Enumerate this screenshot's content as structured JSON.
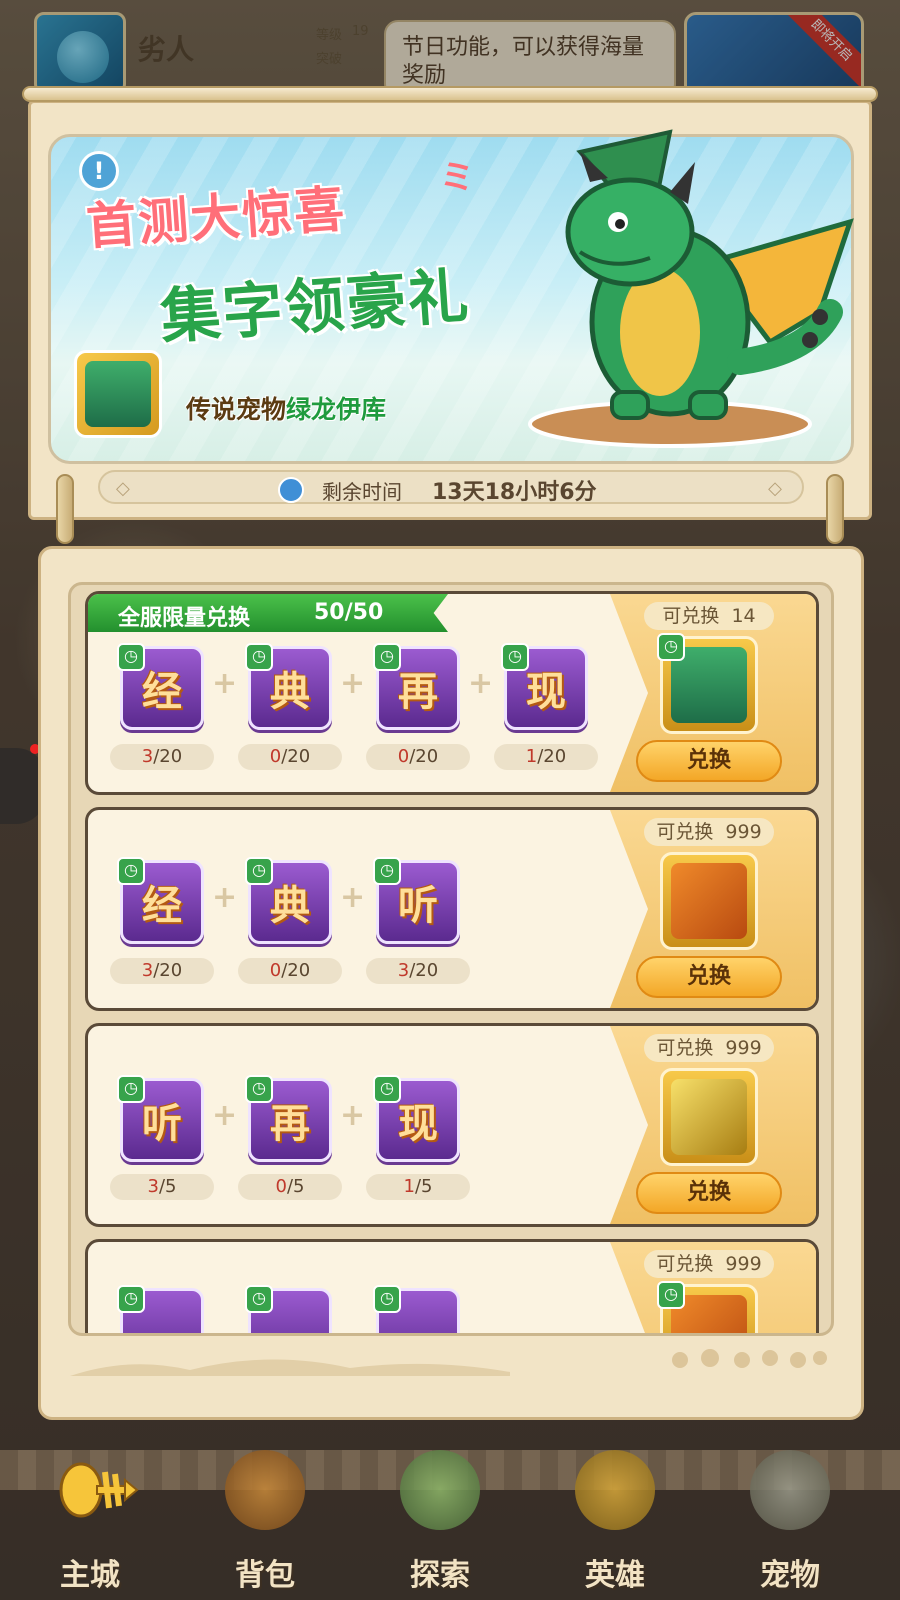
{
  "colors": {
    "accent_green": "#29a44a",
    "accent_pink": "#ff6f79",
    "panel_bg": "#f2e4c6",
    "button_orange": "#f3a727",
    "count_red": "#c0392b"
  },
  "top_bar": {
    "player_name": "劣人",
    "level_label": "等级",
    "level_value": "19",
    "breakthrough_label": "突破",
    "notice_text": "节日功能，可以获得海量奖励",
    "event_ribbon": "即将开启"
  },
  "banner": {
    "headline_1": "首测大惊喜",
    "headline_2": "集字领豪礼",
    "pet_caption_prefix": "传说宠物",
    "pet_caption_name": "绿龙伊库",
    "info_icon": "exclamation-icon"
  },
  "timer": {
    "label": "剩余时间",
    "value": "13天18小时6分"
  },
  "limit_tag": {
    "label": "全服限量兑换",
    "value": "50/50"
  },
  "cards": [
    {
      "items": [
        {
          "char": "经",
          "have": "3",
          "need": "/20"
        },
        {
          "char": "典",
          "have": "0",
          "need": "/20"
        },
        {
          "char": "再",
          "have": "0",
          "need": "/20"
        },
        {
          "char": "现",
          "have": "1",
          "need": "/20"
        }
      ],
      "can_label": "可兑换",
      "can_value": "14",
      "reward": "green-dragon-pet",
      "button": "兑换"
    },
    {
      "items": [
        {
          "char": "经",
          "have": "3",
          "need": "/20"
        },
        {
          "char": "典",
          "have": "0",
          "need": "/20"
        },
        {
          "char": "听",
          "have": "3",
          "need": "/20"
        }
      ],
      "can_label": "可兑换",
      "can_value": "999",
      "reward": "orange-rune-stone",
      "button": "兑换"
    },
    {
      "items": [
        {
          "char": "听",
          "have": "3",
          "need": "/5"
        },
        {
          "char": "再",
          "have": "0",
          "need": "/5"
        },
        {
          "char": "现",
          "have": "1",
          "need": "/5"
        }
      ],
      "can_label": "可兑换",
      "can_value": "999",
      "reward": "gold-card",
      "button": "兑换"
    },
    {
      "can_label": "可兑换",
      "can_value": "999"
    }
  ],
  "bottom_nav": [
    {
      "label": "主城",
      "icon": "fishbone-icon"
    },
    {
      "label": "背包",
      "icon": "bag-icon"
    },
    {
      "label": "探索",
      "icon": "map-icon"
    },
    {
      "label": "英雄",
      "icon": "hero-icon"
    },
    {
      "label": "宠物",
      "icon": "pet-icon"
    }
  ]
}
